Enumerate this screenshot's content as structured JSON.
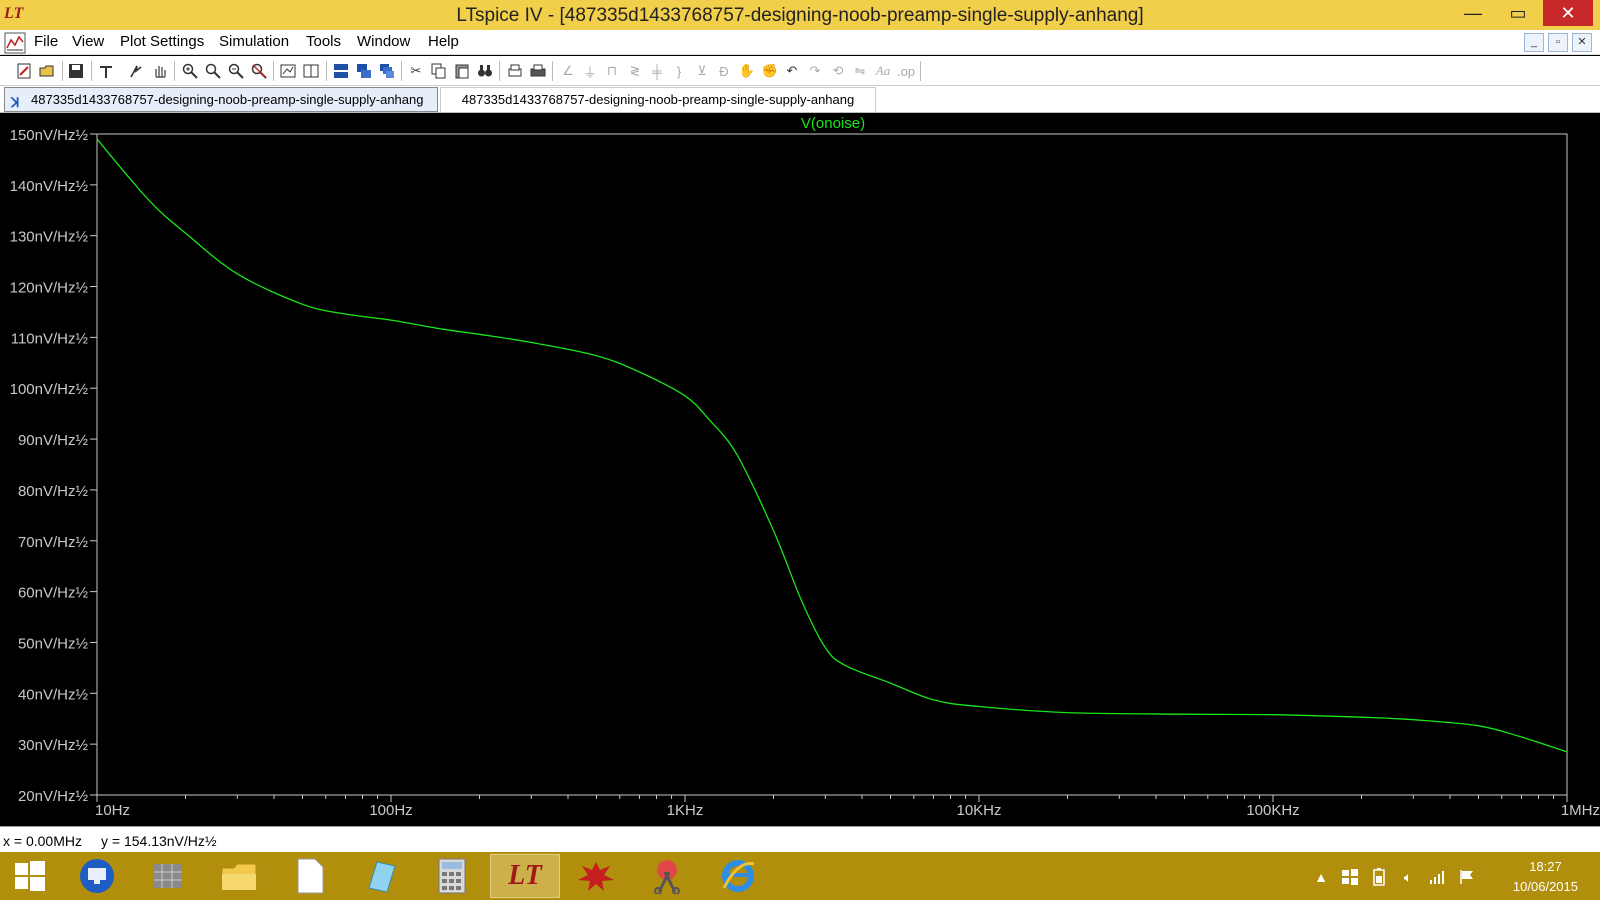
{
  "window": {
    "title": "LTspice IV - [487335d1433768757-designing-noob-preamp-single-supply-anhang]",
    "logo_text": "LT",
    "minimize": "—",
    "maximize": "▭",
    "close": "✕"
  },
  "menu": {
    "items": [
      "File",
      "View",
      "Plot Settings",
      "Simulation",
      "Tools",
      "Window",
      "Help"
    ],
    "mdi_buttons": [
      "_",
      "▫",
      "✕"
    ]
  },
  "toolbar": {
    "icons": [
      "new-schematic",
      "open",
      "save",
      "control-panel",
      "run",
      "pan",
      "zoom-in",
      "zoom-rect",
      "zoom-out",
      "zoom-fit",
      "autorange",
      "marker",
      "tile-horizontal",
      "tile-vertical",
      "cascade",
      "cut",
      "copy",
      "paste",
      "find",
      "print-preview",
      "print",
      "wire",
      "ground",
      "label-net",
      "resistor",
      "capacitor",
      "inductor",
      "diode",
      "component",
      "move",
      "drag",
      "undo",
      "redo",
      "rotate",
      "mirror",
      "text",
      "spice-directive"
    ]
  },
  "tabs": [
    {
      "label": "487335d1433768757-designing-noob-preamp-single-supply-anhang"
    },
    {
      "label": "487335d1433768757-designing-noob-preamp-single-supply-anhang"
    }
  ],
  "colors": {
    "trace": "#19e619",
    "axis": "#c8c8c8",
    "background": "#000000",
    "title_bar": "#f2cf4a",
    "taskbar": "#b18f0d"
  },
  "chart_data": {
    "type": "line",
    "title": "V(onoise)",
    "xscale": "log",
    "xlim": [
      10,
      1000000
    ],
    "ylim": [
      20,
      150
    ],
    "x_ticks": [
      "10Hz",
      "100Hz",
      "1KHz",
      "10KHz",
      "100KHz",
      "1MHz"
    ],
    "y_ticks": [
      "150nV/Hz½",
      "140nV/Hz½",
      "130nV/Hz½",
      "120nV/Hz½",
      "110nV/Hz½",
      "100nV/Hz½",
      "90nV/Hz½",
      "80nV/Hz½",
      "70nV/Hz½",
      "60nV/Hz½",
      "50nV/Hz½",
      "40nV/Hz½",
      "30nV/Hz½",
      "20nV/Hz½"
    ],
    "series": [
      {
        "name": "V(onoise)",
        "x": [
          10,
          15,
          20,
          30,
          50,
          70,
          100,
          150,
          200,
          300,
          500,
          700,
          1000,
          1200,
          1500,
          2000,
          2500,
          3000,
          3500,
          5000,
          7000,
          10000,
          20000,
          50000,
          100000,
          200000,
          300000,
          500000,
          700000,
          1000000
        ],
        "y": [
          149,
          137,
          130.5,
          122.5,
          116.5,
          114.6,
          113.4,
          111.6,
          110.6,
          109,
          106.4,
          103.2,
          98.5,
          94,
          87,
          72,
          58,
          49,
          45.5,
          42,
          38.7,
          37.4,
          36.2,
          35.9,
          35.8,
          35.3,
          34.8,
          33.6,
          31.4,
          28.5
        ]
      }
    ]
  },
  "status": {
    "x_readout": "x = 0.00MHz",
    "y_readout": "y = 154.13nV/Hz½"
  },
  "taskbar": {
    "apps": [
      "start",
      "remote-desktop",
      "server-manager",
      "file-explorer",
      "document",
      "notepad",
      "calculator",
      "ltspice",
      "paint-splash",
      "scissors",
      "internet-explorer"
    ],
    "clock_time": "18:27",
    "clock_date": "10/06/2015"
  }
}
